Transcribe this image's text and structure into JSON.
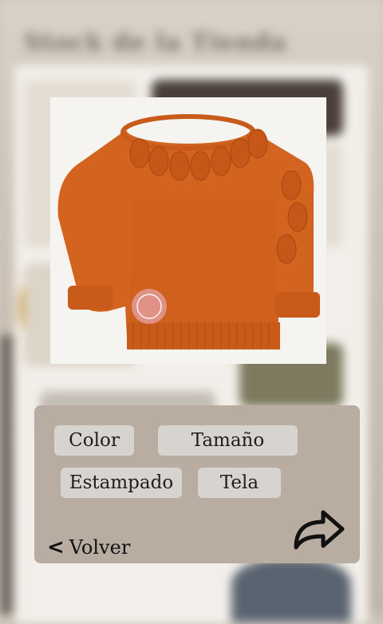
{
  "background": {
    "store_title": "Stock de la Tienda"
  },
  "product": {
    "image": "orange-crochet-sweater",
    "accent_color": "#d2641f",
    "watermark_color": "#e7a3a9"
  },
  "panel": {
    "background_color": "#b9aca1",
    "options": {
      "color": "Color",
      "size": "Tamaño",
      "pattern": "Estampado",
      "fabric": "Tela"
    },
    "back_label": "Volver",
    "back_icon": "chevron-left-icon",
    "share_icon": "share-arrow-icon"
  }
}
